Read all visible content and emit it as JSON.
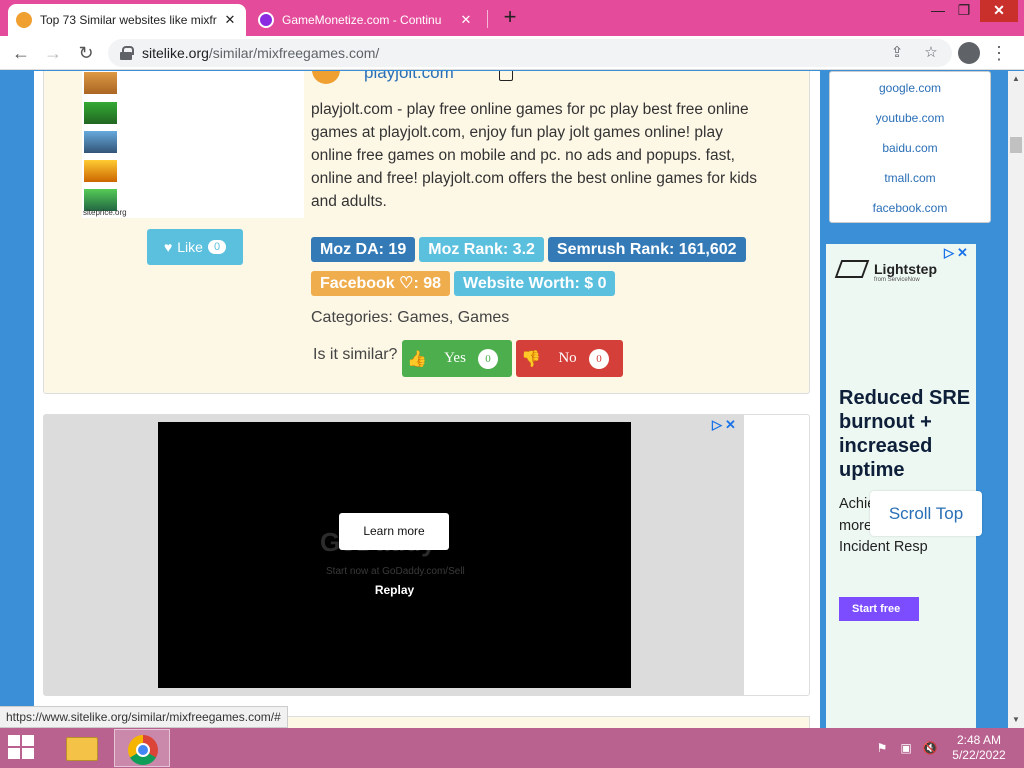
{
  "browser": {
    "tabs": [
      {
        "title": "Top 73 Similar websites like mixfr",
        "active": true,
        "favicon_color": "#f0a030"
      },
      {
        "title": "GameMonetize.com - Continu",
        "active": false,
        "favicon_color": "#8a2be2"
      }
    ],
    "close_glyph": "✕",
    "newtab_glyph": "+",
    "window_controls": {
      "minimize": "—",
      "maximize": "❐",
      "close": "✕"
    },
    "url_host": "sitelike.org",
    "url_path": "/similar/mixfreegames.com/",
    "status_url": "https://www.sitelike.org/similar/mixfreegames.com/#"
  },
  "site_card": {
    "thumbnail_caption": "siteprice.org",
    "like": {
      "label": "Like",
      "count": "0"
    },
    "site_name": "playjolt.com",
    "description": "playjolt.com - play free online games for pc play best free online games at playjolt.com, enjoy fun play jolt games online! play online free games on mobile and pc. no ads and popups. fast, online and free! playjolt.com offers the best online games for kids and adults.",
    "badges_row1": [
      {
        "text": "Moz DA: 19",
        "color": "#337ab7"
      },
      {
        "text": "Moz Rank: 3.2",
        "color": "#5bc0de"
      },
      {
        "text": "Semrush Rank: 161,602",
        "color": "#337ab7"
      }
    ],
    "badges_row2": [
      {
        "text": "Facebook ♡: 98",
        "color": "#f0ad4e"
      },
      {
        "text": "Website Worth: $ 0",
        "color": "#5bc0de"
      }
    ],
    "categories": "Categories: Games, Games",
    "similar_question": "Is it similar?",
    "vote_yes": {
      "label": "Yes",
      "count": "0"
    },
    "vote_no": {
      "label": "No",
      "count": "0"
    }
  },
  "video_ad": {
    "brand": "GoDaddy",
    "brand_sub": "Start now at GoDaddy.com/Sell",
    "learn_more": "Learn more",
    "replay": "Replay",
    "ad_choices": "▷✕"
  },
  "sidebar": {
    "links": [
      "google.com",
      "youtube.com",
      "baidu.com",
      "tmall.com",
      "facebook.com"
    ],
    "ad": {
      "ad_choices": "▷✕",
      "brand": "Lightstep",
      "brand_sub": "from ServiceNow",
      "headline": "Reduced SRE burnout + increased uptime",
      "body": "Achieve this and more with Lightstep Incident Resp",
      "cta": "Start free"
    },
    "scroll_top": "Scroll Top"
  },
  "taskbar": {
    "time": "2:48 AM",
    "date": "5/22/2022"
  },
  "colors": {
    "tabbar": "#e44b9a",
    "page_background": "#3a8fd6",
    "card_background": "#fdf7e6",
    "taskbar": "#b9618f"
  }
}
